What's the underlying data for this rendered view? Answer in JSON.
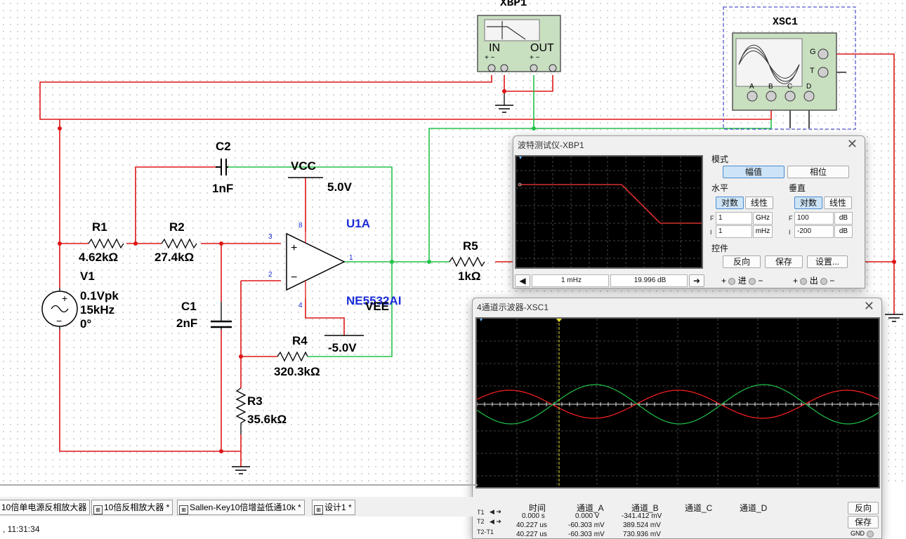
{
  "schematic": {
    "xbp1_label": "XBP1",
    "xbp1_in": "IN",
    "xbp1_out": "OUT",
    "xbp1_in_pins": "+  −",
    "xbp1_out_pins": "+  −",
    "xsc1_label": "XSC1",
    "xsc1_g": "G",
    "xsc1_t": "T",
    "xsc1_channels": [
      "A",
      "B",
      "C",
      "D"
    ],
    "c2_name": "C2",
    "c2_value": "1nF",
    "vcc_name": "VCC",
    "vcc_value": "5.0V",
    "u1a_name": "U1A",
    "u1a_part": "NE5532AI",
    "vee_name": "VEE",
    "vee_value": "-5.0V",
    "r1_name": "R1",
    "r1_value": "4.62kΩ",
    "r2_name": "R2",
    "r2_value": "27.4kΩ",
    "r5_name": "R5",
    "r5_value": "1kΩ",
    "v1_name": "V1",
    "v1_amp": "0.1Vpk",
    "v1_freq": "15kHz",
    "v1_phase": "0°",
    "c1_name": "C1",
    "c1_value": "2nF",
    "r4_name": "R4",
    "r4_value": "320.3kΩ",
    "r3_name": "R3",
    "r3_value": "35.6kΩ",
    "pin3": "3",
    "pin2": "2",
    "pin8": "8",
    "pin4": "4",
    "pin1": "1"
  },
  "bode": {
    "title": "波特测试仪-XBP1",
    "mode_label": "模式",
    "magnitude": "幅值",
    "phase": "相位",
    "horizontal": "水平",
    "vertical": "垂直",
    "log": "对数",
    "linear": "线性",
    "h_final": "1",
    "h_final_unit": "GHz",
    "h_init": "1",
    "h_init_unit": "mHz",
    "v_final": "100",
    "v_final_unit": "dB",
    "v_init": "-200",
    "v_init_unit": "dB",
    "f_tag": "F",
    "i_tag": "I",
    "controls": "控件",
    "reverse": "反向",
    "save": "保存",
    "settings": "设置...",
    "readout_freq": "1 mHz",
    "readout_db": "19.996 dB",
    "in_label": "进",
    "out_label": "出",
    "plus": "+",
    "minus": "−",
    "left_arrow": "◀",
    "right_arrow": "➜"
  },
  "scope": {
    "title": "4通道示波器-XSC1",
    "headers": [
      "时间",
      "通道_A",
      "通道_B",
      "通道_C",
      "通道_D"
    ],
    "rows": [
      {
        "label": "T1",
        "time": "0.000 s",
        "a": "0.000 V",
        "b": "-341.412 mV"
      },
      {
        "label": "T2",
        "time": "40.227 us",
        "a": "-60.303 mV",
        "b": "389.524 mV"
      },
      {
        "label": "T2-T1",
        "time": "40.227 us",
        "a": "-60.303 mV",
        "b": "730.936 mV"
      }
    ],
    "reverse": "反向",
    "save": "保存",
    "gnd": "GND",
    "arrows": "◀ ➜",
    "channel_colors": {
      "a": "#ff2020",
      "b": "#22c24a"
    }
  },
  "tabs": [
    "10倍单电源反相放大器",
    "10倍反相放大器 *",
    "Sallen-Key10倍增益低通10k *",
    "设计1 *"
  ],
  "status_text": ", 11:31:34"
}
